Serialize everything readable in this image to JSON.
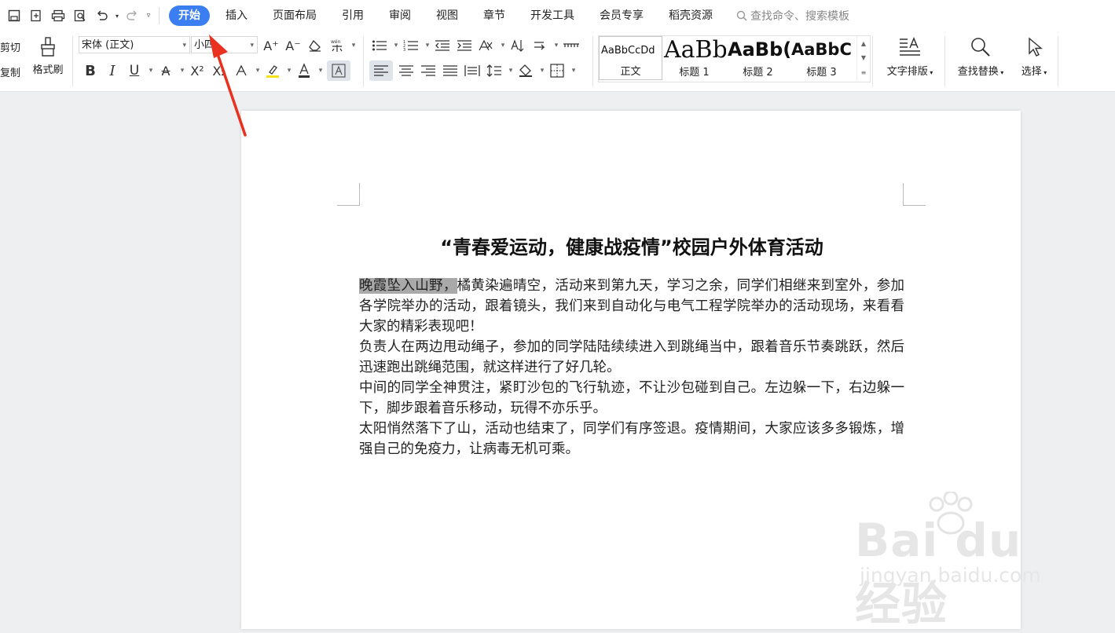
{
  "tabs": {
    "home": "开始",
    "insert": "插入",
    "page_layout": "页面布局",
    "references": "引用",
    "review": "审阅",
    "view": "视图",
    "section": "章节",
    "developer": "开发工具",
    "member": "会员专享",
    "docer": "稻壳资源"
  },
  "search": {
    "placeholder": "查找命令、搜索模板"
  },
  "clipboard": {
    "cut": "剪切",
    "copy": "复制",
    "format_painter": "格式刷"
  },
  "font": {
    "family": "宋体 (正文)",
    "size": "小四"
  },
  "styles": {
    "items": [
      {
        "preview": "AaBbCcDd",
        "label": "正文"
      },
      {
        "preview": "AaBb",
        "label": "标题 1"
      },
      {
        "preview": "AaBb(",
        "label": "标题 2"
      },
      {
        "preview": "AaBbC",
        "label": "标题 3"
      }
    ]
  },
  "tools": {
    "text_layout": "文字排版",
    "find_replace": "查找替换",
    "select": "选择"
  },
  "document": {
    "title": "“青春爱运动，健康战疫情”校园户外体育活动",
    "highlight": "晚霞坠入山野，",
    "p1_rest": "橘黄染遍晴空，活动来到第九天，学习之余，同学们相继来到室外，参加各学院举办的活动，跟着镜头，我们来到自动化与电气工程学院举办的活动现场，来看看大家的精彩表现吧！",
    "p2": "负责人在两边甩动绳子，参加的同学陆陆续续进入到跳绳当中，跟着音乐节奏跳跃，然后迅速跑出跳绳范围，就这样进行了好几轮。",
    "p3": "中间的同学全神贯注，紧盯沙包的飞行轨迹，不让沙包碰到自己。左边躲一下，右边躲一下，脚步跟着音乐移动，玩得不亦乐乎。",
    "p4": "太阳悄然落下了山，活动也结束了，同学们有序签退。疫情期间，大家应该多多锻炼，增强自己的免疫力，让病毒无机可乘。"
  },
  "watermark": {
    "brand": "Bai du 经验",
    "url": "jingyan.baidu.com"
  },
  "colors": {
    "accent": "#3a7ef1",
    "arrow": "#e8321f",
    "highlight": "#a9a9a9"
  }
}
